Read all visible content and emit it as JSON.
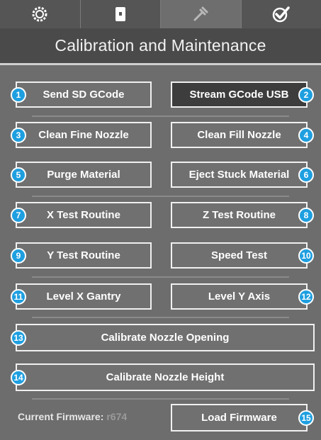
{
  "tabs": [
    {
      "icon": "gear-icon",
      "active": false
    },
    {
      "icon": "printer-cartridge-icon",
      "active": false
    },
    {
      "icon": "wrench-icon",
      "active": true
    },
    {
      "icon": "checkmark-icon",
      "active": false
    }
  ],
  "title": "Calibration and Maintenance",
  "buttons": {
    "send_sd": {
      "label": "Send SD GCode",
      "badge": "1"
    },
    "stream_usb": {
      "label": "Stream GCode USB",
      "badge": "2"
    },
    "clean_fine": {
      "label": "Clean Fine Nozzle",
      "badge": "3"
    },
    "clean_fill": {
      "label": "Clean Fill Nozzle",
      "badge": "4"
    },
    "purge": {
      "label": "Purge Material",
      "badge": "5"
    },
    "eject": {
      "label": "Eject Stuck Material",
      "badge": "6"
    },
    "x_test": {
      "label": "X Test Routine",
      "badge": "7"
    },
    "z_test": {
      "label": "Z Test Routine",
      "badge": "8"
    },
    "y_test": {
      "label": "Y Test Routine",
      "badge": "9"
    },
    "speed_test": {
      "label": "Speed Test",
      "badge": "10"
    },
    "level_x": {
      "label": "Level X Gantry",
      "badge": "11"
    },
    "level_y": {
      "label": "Level Y Axis",
      "badge": "12"
    },
    "cal_opening": {
      "label": "Calibrate Nozzle Opening",
      "badge": "13"
    },
    "cal_height": {
      "label": "Calibrate Nozzle Height",
      "badge": "14"
    },
    "load_fw": {
      "label": "Load Firmware",
      "badge": "15"
    }
  },
  "firmware": {
    "label": "Current Firmware:",
    "version": "r674"
  },
  "colors": {
    "badge": "#1e9fe0",
    "background": "#6d6d6d",
    "title_bg": "#4a4a4a"
  }
}
